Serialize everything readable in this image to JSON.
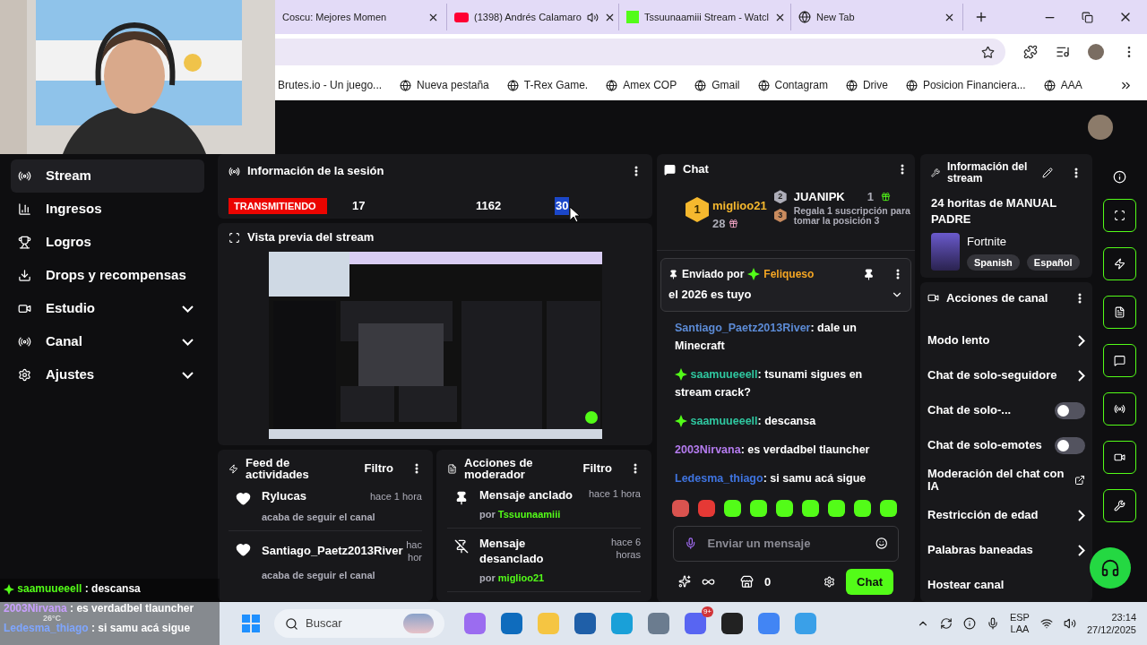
{
  "browser": {
    "tabs": [
      {
        "title": "Coscu: Mejores Momen",
        "kind": "plain"
      },
      {
        "title": "(1398) Andrés Calamaro",
        "kind": "audio"
      },
      {
        "title": "Tssuunaamiii Stream - Watcl",
        "kind": "kick"
      },
      {
        "title": "New Tab",
        "kind": "chrome"
      }
    ],
    "bookmarks": [
      "Brutes.io - Un juego...",
      "Nueva pestaña",
      "T-Rex Game.",
      "Amex COP",
      "Gmail",
      "Contagram",
      "Drive",
      "Posicion Financiera...",
      "AAA"
    ]
  },
  "sidebar": {
    "items": [
      {
        "label": "Stream",
        "selected": true,
        "expandable": false
      },
      {
        "label": "Ingresos",
        "selected": false,
        "expandable": false
      },
      {
        "label": "Logros",
        "selected": false,
        "expandable": false
      },
      {
        "label": "Drops y recompensas",
        "selected": false,
        "expandable": false
      },
      {
        "label": "Estudio",
        "selected": false,
        "expandable": true
      },
      {
        "label": "Canal",
        "selected": false,
        "expandable": true
      },
      {
        "label": "Ajustes",
        "selected": false,
        "expandable": true
      }
    ]
  },
  "session": {
    "title": "Información de la sesión",
    "status": "TRANSMITIENDO",
    "stats": [
      {
        "value": "17",
        "highlighted": false
      },
      {
        "value": "1162",
        "highlighted": false
      },
      {
        "value": "30",
        "highlighted": true
      }
    ]
  },
  "preview": {
    "title": "Vista previa del stream"
  },
  "activity_feed": {
    "title": "Feed de actividades",
    "filter": "Filtro",
    "items": [
      {
        "user": "Rylucas",
        "time": [
          "hace 1 hora"
        ],
        "text": "acaba de seguir el canal"
      },
      {
        "user": "Santiago_Paetz2013River",
        "time": [
          "hac",
          "hor"
        ],
        "text": "acaba de seguir el canal"
      }
    ]
  },
  "mod_actions": {
    "title": "Acciones de moderador",
    "filter": "Filtro",
    "items": [
      {
        "kind": "pin",
        "action": "Mensaje anclado",
        "time": [
          "hace 1 hora"
        ],
        "by_label": "por",
        "by": "Tssuunaamiii"
      },
      {
        "kind": "unpin",
        "action": "Mensaje desanclado",
        "time": [
          "hace 6",
          "horas"
        ],
        "by_label": "por",
        "by": "miglioo21"
      }
    ]
  },
  "chat": {
    "title": "Chat",
    "leaders": [
      {
        "rank": "1",
        "name": "miglioo21",
        "count": "28"
      },
      {
        "rank": "2",
        "name": "JUANIPK",
        "count": "1"
      },
      {
        "rank": "3",
        "name": "Regala 1 suscripción para tomar la posición 3"
      }
    ],
    "pinned": {
      "label": "Enviado por",
      "user": "Feliqueso",
      "text": "el 2026 es tuyo"
    },
    "messages": [
      {
        "user": "Santiago_Paetz2013River",
        "color": "#5c8bd6",
        "badge": false,
        "text": ": dale un Minecraft"
      },
      {
        "user": "saamuueeell",
        "color": "#2fc7a0",
        "badge": true,
        "text": ": tsunami sigues en stream crack?"
      },
      {
        "user": "saamuueeell",
        "color": "#2fc7a0",
        "badge": true,
        "text": ": descansa"
      },
      {
        "user": "2003Nirvana",
        "color": "#b57cf0",
        "badge": false,
        "text": ": es verdadbel tlauncher"
      },
      {
        "user": "Ledesma_thiago",
        "color": "#3f74e0",
        "badge": false,
        "text": ": si samu acá sigue"
      }
    ],
    "input": {
      "placeholder": "Enviar un mensaje"
    },
    "points": "0",
    "send": "Chat"
  },
  "stream_info": {
    "title": "Información del stream",
    "stream_title": "24 horitas de MANUAL PADRE",
    "category": "Fortnite",
    "tags": [
      "Spanish",
      "Español"
    ]
  },
  "channel_actions": {
    "title": "Acciones de canal",
    "items": [
      {
        "label": "Modo lento",
        "kind": "link"
      },
      {
        "label": "Chat de solo-seguidore",
        "kind": "link"
      },
      {
        "label": "Chat de solo-...",
        "kind": "toggle",
        "on": false
      },
      {
        "label": "Chat de solo-emotes",
        "kind": "toggle",
        "on": false
      },
      {
        "label": "Moderación del chat con IA",
        "kind": "external"
      },
      {
        "label": "Restricción de edad",
        "kind": "link"
      },
      {
        "label": "Palabras baneadas",
        "kind": "link"
      },
      {
        "label": "Hostear canal",
        "kind": "plain"
      }
    ]
  },
  "overlay_chat": [
    {
      "user": "saamuueeell",
      "color": "#53fc18",
      "badge": true,
      "text": " : descansa"
    },
    {
      "user": "2003Nirvana",
      "color": "#c9a0ff",
      "badge": false,
      "text": " : es verdadbel tlauncher"
    },
    {
      "user": "Ledesma_thiago",
      "color": "#7fa6ff",
      "badge": false,
      "text": " : si samu acá sigue"
    }
  ],
  "taskbar": {
    "weather": "26°C",
    "search": {
      "placeholder": "Buscar"
    },
    "notification_badge": "9+",
    "language": [
      "ESP",
      "LAA"
    ],
    "time": "23:14",
    "date": "27/12/2025"
  }
}
